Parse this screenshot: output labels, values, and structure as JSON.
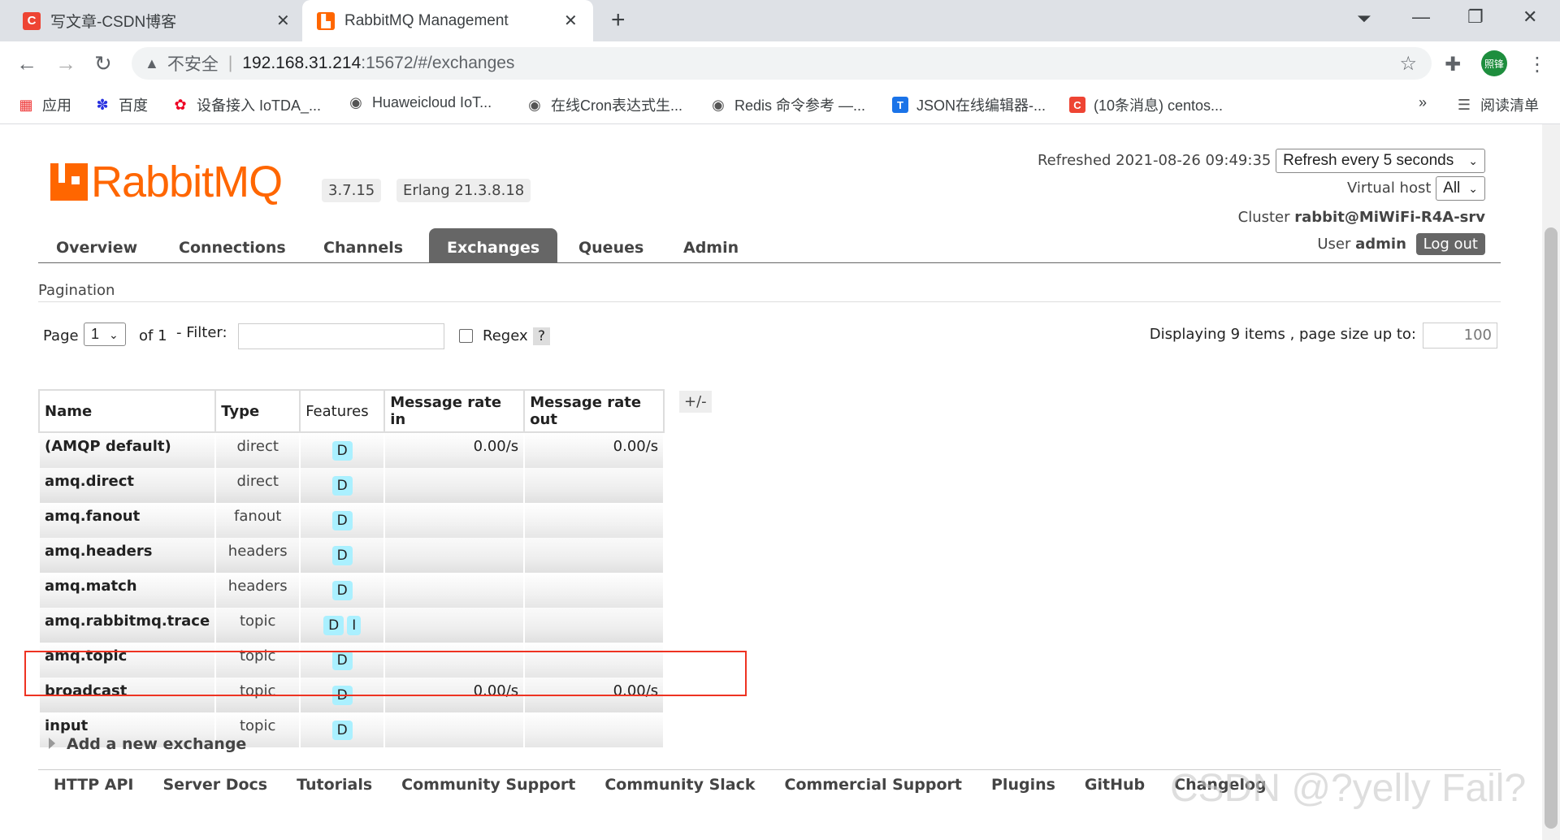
{
  "browser": {
    "tabs": [
      {
        "title": "写文章-CSDN博客",
        "icon": "csdn-icon"
      },
      {
        "title": "RabbitMQ Management",
        "icon": "rabbitmq-icon"
      }
    ],
    "address": {
      "security": "不安全",
      "host": "192.168.31.214",
      "path": ":15672/#/exchanges"
    },
    "profile_initials": "照锋",
    "bookmarks": [
      {
        "label": "应用",
        "icon": "apps-grid-icon"
      },
      {
        "label": "百度",
        "icon": "baidu-paw-icon"
      },
      {
        "label": "设备接入 IoTDA_...",
        "icon": "huawei-icon"
      },
      {
        "label": "Huaweicloud IoT...",
        "icon": "globe-icon"
      },
      {
        "label": "在线Cron表达式生...",
        "icon": "globe-icon"
      },
      {
        "label": "Redis 命令参考 —...",
        "icon": "globe-icon"
      },
      {
        "label": "JSON在线编辑器-...",
        "icon": "json-t-icon"
      },
      {
        "label": "(10条消息) centos...",
        "icon": "csdn-icon"
      }
    ],
    "bookmarks_more": "»",
    "reading_list": "阅读清单"
  },
  "app": {
    "logo_text": "RabbitMQ",
    "version": "3.7.15",
    "erlang": "Erlang 21.3.8.18",
    "refreshed_label": "Refreshed 2021-08-26 09:49:35",
    "refresh_select": "Refresh every 5 seconds",
    "vhost_label": "Virtual host",
    "vhost_select": "All",
    "cluster_label": "Cluster",
    "cluster_name": "rabbit@MiWiFi-R4A-srv",
    "user_label": "User",
    "user_name": "admin",
    "logout": "Log out",
    "nav": [
      "Overview",
      "Connections",
      "Channels",
      "Exchanges",
      "Queues",
      "Admin"
    ],
    "active_nav": "Exchanges"
  },
  "pagination": {
    "title": "Pagination",
    "page_label": "Page",
    "page_value": "1",
    "of_label": "of 1",
    "filter_label": "- Filter:",
    "regex_label": "Regex",
    "help": "?",
    "displaying": "Displaying 9 items , page size up to:",
    "page_size": "100"
  },
  "table": {
    "columns": [
      "Name",
      "Type",
      "Features",
      "Message rate in",
      "Message rate out"
    ],
    "toggle": "+/-",
    "rows": [
      {
        "name": "(AMQP default)",
        "type": "direct",
        "features": [
          "D"
        ],
        "rate_in": "0.00/s",
        "rate_out": "0.00/s"
      },
      {
        "name": "amq.direct",
        "type": "direct",
        "features": [
          "D"
        ],
        "rate_in": "",
        "rate_out": ""
      },
      {
        "name": "amq.fanout",
        "type": "fanout",
        "features": [
          "D"
        ],
        "rate_in": "",
        "rate_out": ""
      },
      {
        "name": "amq.headers",
        "type": "headers",
        "features": [
          "D"
        ],
        "rate_in": "",
        "rate_out": ""
      },
      {
        "name": "amq.match",
        "type": "headers",
        "features": [
          "D"
        ],
        "rate_in": "",
        "rate_out": ""
      },
      {
        "name": "amq.rabbitmq.trace",
        "type": "topic",
        "features": [
          "D",
          "I"
        ],
        "rate_in": "",
        "rate_out": ""
      },
      {
        "name": "amq.topic",
        "type": "topic",
        "features": [
          "D"
        ],
        "rate_in": "",
        "rate_out": ""
      },
      {
        "name": "broadcast",
        "type": "topic",
        "features": [
          "D"
        ],
        "rate_in": "0.00/s",
        "rate_out": "0.00/s"
      },
      {
        "name": "input",
        "type": "topic",
        "features": [
          "D"
        ],
        "rate_in": "",
        "rate_out": ""
      }
    ]
  },
  "add_exchange": "Add a new exchange",
  "footer": [
    "HTTP API",
    "Server Docs",
    "Tutorials",
    "Community Support",
    "Community Slack",
    "Commercial Support",
    "Plugins",
    "GitHub",
    "Changelog"
  ],
  "watermark": "CSDN @?yelly Fail?",
  "colors": {
    "brand": "#ff6600",
    "highlight": "#ee3322",
    "feature_badge": "#aaf0ff"
  }
}
